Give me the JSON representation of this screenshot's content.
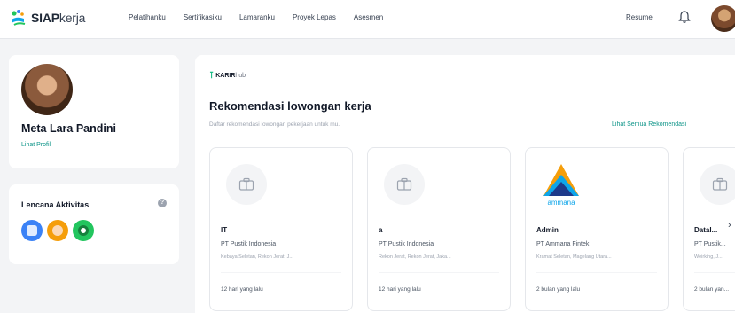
{
  "nav": {
    "logo_bold": "SIAP",
    "logo_light": "kerja",
    "items": [
      "Pelatihanku",
      "Sertifikasiku",
      "Lamaranku",
      "Proyek Lepas",
      "Asesmen"
    ],
    "resume_label": "Resume"
  },
  "profile": {
    "name": "Meta Lara Pandini",
    "link_label": "Lihat Profil"
  },
  "badges": {
    "title": "Lencana Aktivitas",
    "info_icon": "?"
  },
  "recommendations": {
    "partner_mark": "⊺",
    "partner_name_bold": "KARIR",
    "partner_name_light": "hub",
    "title": "Rekomendasi lowongan kerja",
    "subtitle": "Daftar rekomendasi lowongan pekerjaan untuk mu.",
    "see_all_label": "Lihat Semua Rekomendasi",
    "jobs": [
      {
        "title": "IT",
        "company": "PT Pustik Indonesia",
        "meta": "Kebaya Seletan, Rekon Jerat, J...",
        "posted": "12 hari yang lalu",
        "logo": "briefcase-icon"
      },
      {
        "title": "a",
        "company": "PT Pustik Indonesia",
        "meta": "Rekon Jerat, Rekon Jerat, Jaka...",
        "posted": "12 hari yang lalu",
        "logo": "briefcase-icon"
      },
      {
        "title": "Admin",
        "company": "PT Ammana Fintek",
        "meta": "Kramat Seletan, Magelang Utara...",
        "posted": "2 bulan yang lalu",
        "logo": "ammana-logo",
        "logo_text": "ammana"
      },
      {
        "title": "Datal...",
        "company": "PT Pustik...",
        "meta": "Weirking, J...",
        "posted": "2 bulan yan...",
        "logo": "briefcase-icon"
      }
    ]
  },
  "colors": {
    "accent": "#0d9488",
    "background": "#f3f4f6",
    "card": "#ffffff"
  }
}
